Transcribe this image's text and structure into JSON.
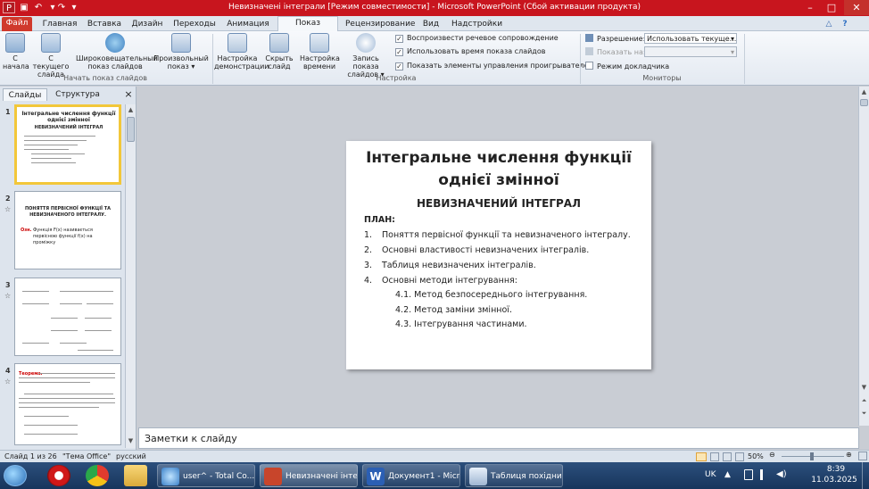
{
  "window": {
    "title": "Невизначені інтеграли [Режим совместимости]  -  Microsoft PowerPoint (Сбой активации продукта)",
    "accent": "#c8151e"
  },
  "ribbon_tabs": [
    {
      "label": "Файл"
    },
    {
      "label": "Главная"
    },
    {
      "label": "Вставка"
    },
    {
      "label": "Дизайн"
    },
    {
      "label": "Переходы"
    },
    {
      "label": "Анимация"
    },
    {
      "label": "Показ слайдов"
    },
    {
      "label": "Рецензирование"
    },
    {
      "label": "Вид"
    },
    {
      "label": "Надстройки"
    }
  ],
  "ribbon": {
    "start_group": {
      "label": "Начать показ слайдов",
      "from_start": [
        "С",
        "начала"
      ],
      "from_current": [
        "С текущего",
        "слайда"
      ],
      "broadcast": [
        "Широковещательный",
        "показ слайдов"
      ],
      "custom": [
        "Произвольный",
        "показ"
      ]
    },
    "setup_group": {
      "label": "Настройка",
      "setup_show": [
        "Настройка",
        "демонстрации"
      ],
      "hide_slide": [
        "Скрыть",
        "слайд"
      ],
      "rehearse": [
        "Настройка",
        "времени"
      ],
      "record": [
        "Запись показа",
        "слайдов"
      ],
      "play_narrations": "Воспроизвести речевое сопровождение",
      "use_timings": "Использовать время показа слайдов",
      "show_media_controls": "Показать элементы управления проигрывателем"
    },
    "monitors_group": {
      "label": "Мониторы",
      "resolution_label": "Разрешение:",
      "resolution_value": "Использовать текуще...",
      "show_on_label": "Показать на:",
      "presenter_view": "Режим докладчика"
    }
  },
  "left_panel": {
    "tab_slides": "Слайды",
    "tab_outline": "Структура",
    "close": "×",
    "thumbnails": [
      {
        "num": "1",
        "title": "Інтегральне числення функції однієї змінної",
        "subtitle": "НЕВИЗНАЧЕНИЙ ІНТЕГРАЛ"
      },
      {
        "num": "2",
        "title": "ПОНЯТТЯ ПЕРВІСНОЇ ФУНКЦІЇ ТА НЕВИЗНАЧЕНОГО ІНТЕГРАЛУ.",
        "def_label": "Озн.",
        "def_text": "Функція F(x) називається первісною функції f(x) на проміжку"
      },
      {
        "num": "3"
      },
      {
        "num": "4",
        "label": "Теорема."
      }
    ]
  },
  "slide": {
    "title_line1": "Інтегральне числення функції",
    "title_line2": "однієї змінної",
    "subtitle": "НЕВИЗНАЧЕНИЙ ІНТЕГРАЛ",
    "plan_label": "ПЛАН:",
    "items": [
      {
        "num": "1.",
        "text": "Поняття первісної функції та невизначеного інтегралу."
      },
      {
        "num": "2.",
        "text": "Основні властивості невизначених інтегралів."
      },
      {
        "num": "3.",
        "text": "Таблиця невизначених інтегралів."
      },
      {
        "num": "4.",
        "text": "Основні методи інтегрування:"
      }
    ],
    "subitems": [
      "4.1. Метод безпосереднього інтегрування.",
      "4.2. Метод заміни змінної.",
      "4.3. Інтегрування частинами."
    ]
  },
  "notes": {
    "placeholder": "Заметки к слайду"
  },
  "status_bar": {
    "slide_info": "Слайд 1 из 26",
    "theme": "\"Тема Office\"",
    "language": "русский",
    "zoom": "50%"
  },
  "taskbar": {
    "items": [
      {
        "label": "user^ - Total Co..."
      },
      {
        "label": "Невизначені інте..."
      },
      {
        "label": "Документ1 - Micr..."
      },
      {
        "label": "Таблиця похідни..."
      }
    ],
    "lang": "UK",
    "time": "8:39",
    "date": "11.03.2025"
  }
}
